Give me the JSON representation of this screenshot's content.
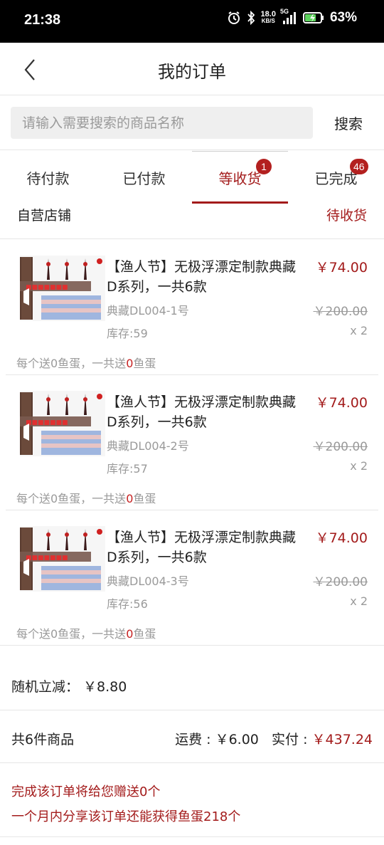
{
  "status_bar": {
    "time": "21:38",
    "net_speed": "18.0",
    "net_unit": "KB/S",
    "signal": "5G",
    "battery": "63%"
  },
  "header": {
    "title": "我的订单"
  },
  "search": {
    "placeholder": "请输入需要搜索的商品名称",
    "button_label": "搜索"
  },
  "tabs": [
    {
      "label": "待付款",
      "badge": ""
    },
    {
      "label": "已付款",
      "badge": ""
    },
    {
      "label": "等收货",
      "badge": "1",
      "active": true
    },
    {
      "label": "已完成",
      "badge": "46"
    }
  ],
  "order": {
    "store_name": "自营店铺",
    "status": "待收货",
    "items": [
      {
        "name": "【渔人节】无极浮漂定制款典藏D系列，一共6款",
        "price": "￥74.00",
        "spec": "典藏DL004-1号",
        "original_price": "￥200.00",
        "stock": "库存:59",
        "qty": "x 2",
        "gift_prefix": "每个送0鱼蛋，一共送",
        "gift_count": "0",
        "gift_suffix": "鱼蛋"
      },
      {
        "name": "【渔人节】无极浮漂定制款典藏D系列，一共6款",
        "price": "￥74.00",
        "spec": "典藏DL004-2号",
        "original_price": "￥200.00",
        "stock": "库存:57",
        "qty": "x 2",
        "gift_prefix": "每个送0鱼蛋，一共送",
        "gift_count": "0",
        "gift_suffix": "鱼蛋"
      },
      {
        "name": "【渔人节】无极浮漂定制款典藏D系列，一共6款",
        "price": "￥74.00",
        "spec": "典藏DL004-3号",
        "original_price": "￥200.00",
        "stock": "库存:56",
        "qty": "x 2",
        "gift_prefix": "每个送0鱼蛋，一共送",
        "gift_count": "0",
        "gift_suffix": "鱼蛋"
      }
    ],
    "discount": "随机立减： ￥8.80",
    "item_count": "共6件商品",
    "shipping_label": "运费 : ￥6.00",
    "paid_label": "实付 : ",
    "paid_amount": "￥437.24",
    "note_line1": "完成该订单将给您赠送0个",
    "note_line2": "一个月内分享该订单还能获得鱼蛋218个"
  }
}
